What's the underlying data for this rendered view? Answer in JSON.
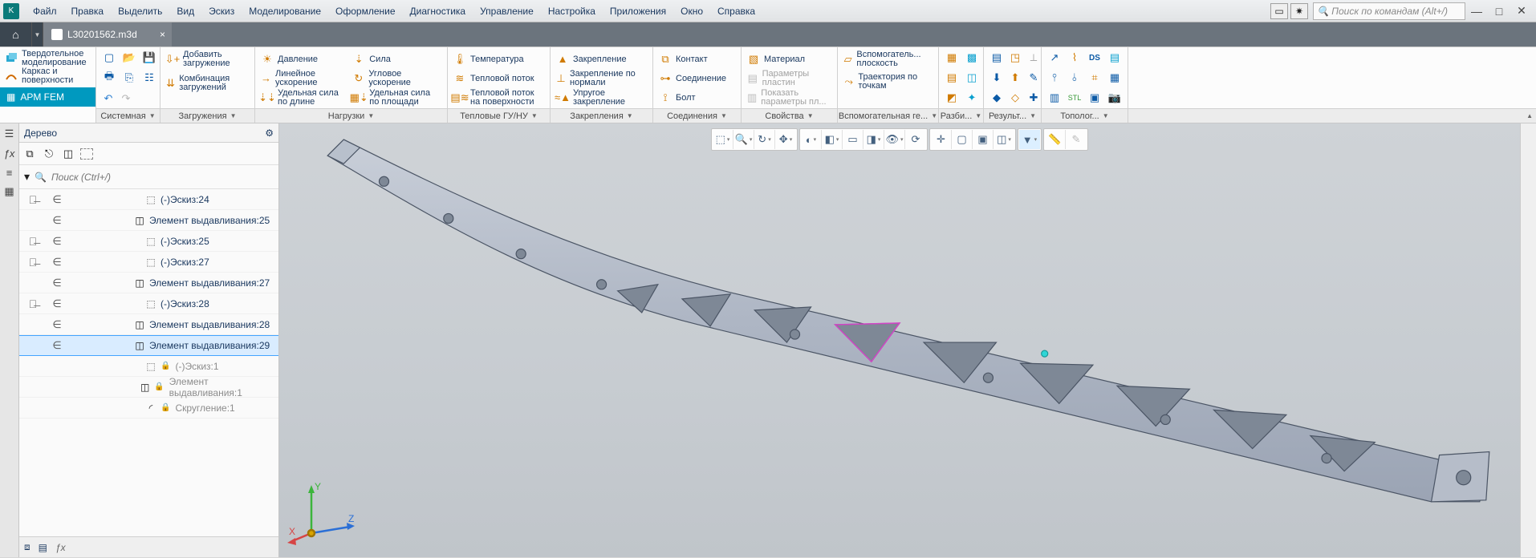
{
  "menu": {
    "items": [
      "Файл",
      "Правка",
      "Выделить",
      "Вид",
      "Эскиз",
      "Моделирование",
      "Оформление",
      "Диагностика",
      "Управление",
      "Настройка",
      "Приложения",
      "Окно",
      "Справка"
    ],
    "search_placeholder": "Поиск по командам (Alt+/)"
  },
  "tabs": {
    "document": "L30201562.m3d"
  },
  "modes": {
    "solid": "Твердотельное моделирование",
    "wire": "Каркас и поверхности",
    "apm": "APM FEM"
  },
  "ribbon": {
    "panels": {
      "system": "Системная",
      "loads_cases": "Загружения",
      "loads": "Нагрузки",
      "thermal": "Тепловые ГУ/НУ",
      "restraints": "Закрепления",
      "connections": "Соединения",
      "properties": "Свойства",
      "aux": "Вспомогательная ге...",
      "splits": "Разби...",
      "results": "Результ...",
      "topology": "Тополог..."
    },
    "loads_cases": {
      "add": "Добавить загружение",
      "combo": "Комбинация загружений"
    },
    "loads": {
      "pressure": "Давление",
      "lin_accel": "Линейное ускорение",
      "dist_len": "Удельная сила по длине",
      "force": "Сила",
      "ang_accel": "Угловое ускорение",
      "dist_area": "Удельная сила по площади"
    },
    "thermal": {
      "temp": "Температура",
      "flux": "Тепловой поток",
      "flux_surf": "Тепловой поток на поверхности"
    },
    "restraints": {
      "fix": "Закрепление",
      "fix_normal": "Закрепление по нормали",
      "elastic": "Упругое закрепление"
    },
    "connections": {
      "contact": "Контакт",
      "joint": "Соединение",
      "bolt": "Болт"
    },
    "properties": {
      "material": "Материал",
      "plate_params": "Параметры пластин",
      "show_params": "Показать параметры пл..."
    },
    "aux": {
      "aux_plane": "Вспомогатель... плоскость",
      "traj": "Траектория по точкам"
    }
  },
  "tree": {
    "title": "Дерево",
    "search_placeholder": "Поиск (Ctrl+/)",
    "items": [
      {
        "vis": "hidden",
        "inc": "in",
        "type": "sketch",
        "label": "(-)Эскиз:24",
        "indent": 2,
        "dim": false
      },
      {
        "vis": "",
        "inc": "in",
        "type": "extrude",
        "label": "Элемент выдавливания:25",
        "indent": 1,
        "dim": false
      },
      {
        "vis": "hidden",
        "inc": "in",
        "type": "sketch",
        "label": "(-)Эскиз:25",
        "indent": 2,
        "dim": false
      },
      {
        "vis": "hidden",
        "inc": "in",
        "type": "sketch",
        "label": "(-)Эскиз:27",
        "indent": 2,
        "dim": false
      },
      {
        "vis": "",
        "inc": "in",
        "type": "extrude",
        "label": "Элемент выдавливания:27",
        "indent": 1,
        "dim": false
      },
      {
        "vis": "hidden",
        "inc": "in",
        "type": "sketch",
        "label": "(-)Эскиз:28",
        "indent": 2,
        "dim": false
      },
      {
        "vis": "",
        "inc": "in",
        "type": "extrude",
        "label": "Элемент выдавливания:28",
        "indent": 1,
        "dim": false
      },
      {
        "vis": "",
        "inc": "in",
        "type": "extrude",
        "label": "Элемент выдавливания:29",
        "indent": 1,
        "dim": false,
        "sel": true
      },
      {
        "vis": "",
        "inc": "",
        "type": "sketch",
        "label": "(-)Эскиз:1",
        "indent": 2,
        "dim": true,
        "lock": true
      },
      {
        "vis": "",
        "inc": "",
        "type": "extrude",
        "label": "Элемент выдавливания:1",
        "indent": 2,
        "dim": true,
        "lock": true
      },
      {
        "vis": "",
        "inc": "",
        "type": "fillet",
        "label": "Скругление:1",
        "indent": 2,
        "dim": true,
        "lock": true
      }
    ]
  },
  "triad": {
    "x": "X",
    "y": "Y",
    "z": "Z"
  }
}
